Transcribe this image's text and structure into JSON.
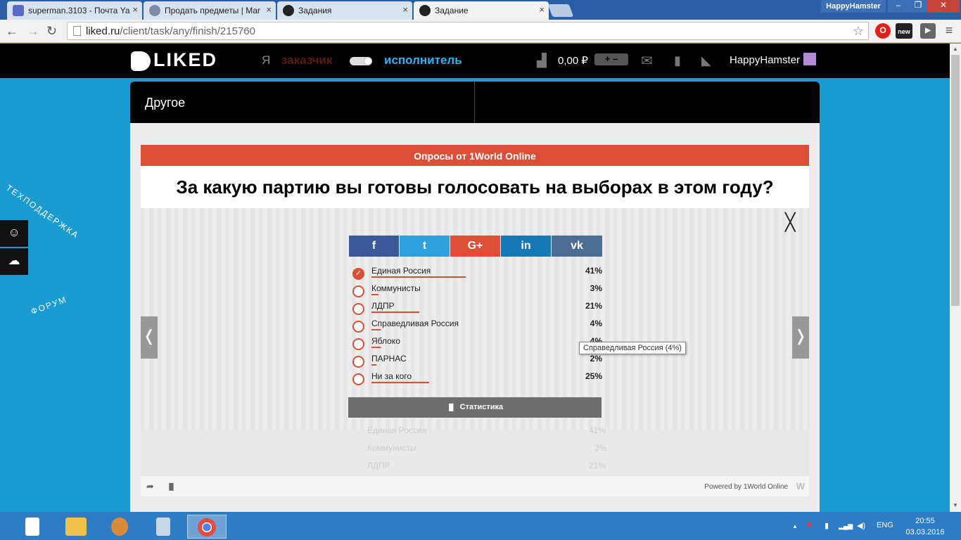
{
  "browser": {
    "tabs": [
      {
        "title": "superman.3103 - Почта Ya",
        "icon": "mail-icon",
        "color": "#5a6ac9"
      },
      {
        "title": "Продать предметы | Mar",
        "icon": "globe-icon",
        "color": "#7a8ca8"
      },
      {
        "title": "Задания",
        "icon": "liked-icon",
        "color": "#222222"
      },
      {
        "title": "Задание",
        "icon": "liked-icon",
        "color": "#222222"
      }
    ],
    "close_glyph": "×",
    "window_user": "HappyHamster",
    "window_controls": [
      "–",
      "❐",
      "✕"
    ],
    "nav": {
      "back": "←",
      "forward": "→",
      "reload": "↻"
    },
    "url_host": "liked.ru",
    "url_path": "/client/task/any/finish/215760",
    "star": "☆",
    "extensions": [
      {
        "name": "opera-extension-icon",
        "label": "O",
        "color": "#e0201b"
      },
      {
        "name": "new-extension-icon",
        "label": "new",
        "color": "#222222"
      },
      {
        "name": "forward-extension-icon",
        "label": "▶",
        "color": "#666666"
      },
      {
        "name": "menu-icon",
        "label": "≡",
        "color": "#f2f2f2"
      }
    ]
  },
  "site": {
    "logo": "LIKED",
    "role_prefix": "Я",
    "role_customer": "заказчик",
    "role_executor": "исполнитель",
    "wallet_glyph": "▟",
    "balance": "0,00 ₽",
    "plus_minus": "+ –",
    "mail_glyph": "✉",
    "trash_glyph": "▮",
    "basket_glyph": "◣",
    "username": "HappyHamster"
  },
  "side": {
    "support": "ТЕХПОДДЕРЖКА",
    "forum": "ФОРУМ",
    "support_icon": "☺",
    "forum_icon": "☁"
  },
  "panel": {
    "category": "Другое"
  },
  "widget": {
    "header": "Опросы от 1World Online",
    "question": "За какую партию вы готовы голосовать на выборах в этом году?",
    "close": "╳",
    "prev": "❬",
    "next": "❭",
    "share": [
      {
        "name": "facebook",
        "label": "f",
        "color": "#3b5998"
      },
      {
        "name": "twitter",
        "label": "t",
        "color": "#2ea0dd"
      },
      {
        "name": "google-plus",
        "label": "G+",
        "color": "#dc4e35"
      },
      {
        "name": "linkedin",
        "label": "in",
        "color": "#1679b5"
      },
      {
        "name": "vk",
        "label": "vk",
        "color": "#4c6c91"
      }
    ],
    "options": [
      {
        "label": "Единая Россия",
        "percent": "41%",
        "value": 41,
        "selected": true
      },
      {
        "label": "Коммунисты",
        "percent": "3%",
        "value": 3,
        "selected": false
      },
      {
        "label": "ЛДПР",
        "percent": "21%",
        "value": 21,
        "selected": false
      },
      {
        "label": "Справедливая Россия",
        "percent": "4%",
        "value": 4,
        "selected": false
      },
      {
        "label": "Яблоко",
        "percent": "4%",
        "value": 4,
        "selected": false
      },
      {
        "label": "ПАРНАС",
        "percent": "2%",
        "value": 2,
        "selected": false
      },
      {
        "label": "Ни за кого",
        "percent": "25%",
        "value": 25,
        "selected": false
      }
    ],
    "check": "✓",
    "stats_label": "Статистика",
    "stats_icon": "▐▌",
    "tooltip": "Справедливая Россия (4%)",
    "ghost_rows": [
      {
        "label": "Единая Россия",
        "percent": "41%"
      },
      {
        "label": "Коммунисты",
        "percent": "3%"
      },
      {
        "label": "ЛДПР",
        "percent": "21%"
      }
    ],
    "powered": "Powered by 1World Online",
    "footer_share": "➦",
    "footer_stats": "▐▌",
    "footer_logo": "W"
  },
  "taskbar": {
    "apps": [
      {
        "name": "file-icon",
        "color": "#ffffff"
      },
      {
        "name": "explorer-icon",
        "color": "#f0c24a"
      },
      {
        "name": "paint-icon",
        "color": "#d98b3a"
      },
      {
        "name": "calculator-icon",
        "color": "#c9d6e4"
      },
      {
        "name": "chrome-icon",
        "color": "#e84a3c"
      }
    ],
    "tray_up": "▲",
    "tray_flag": "⚑",
    "tray_battery": "▮",
    "tray_signal": "▂▄▆",
    "tray_volume": "◀)",
    "lang": "ENG",
    "time": "20:55",
    "date": "03.03.2016"
  }
}
